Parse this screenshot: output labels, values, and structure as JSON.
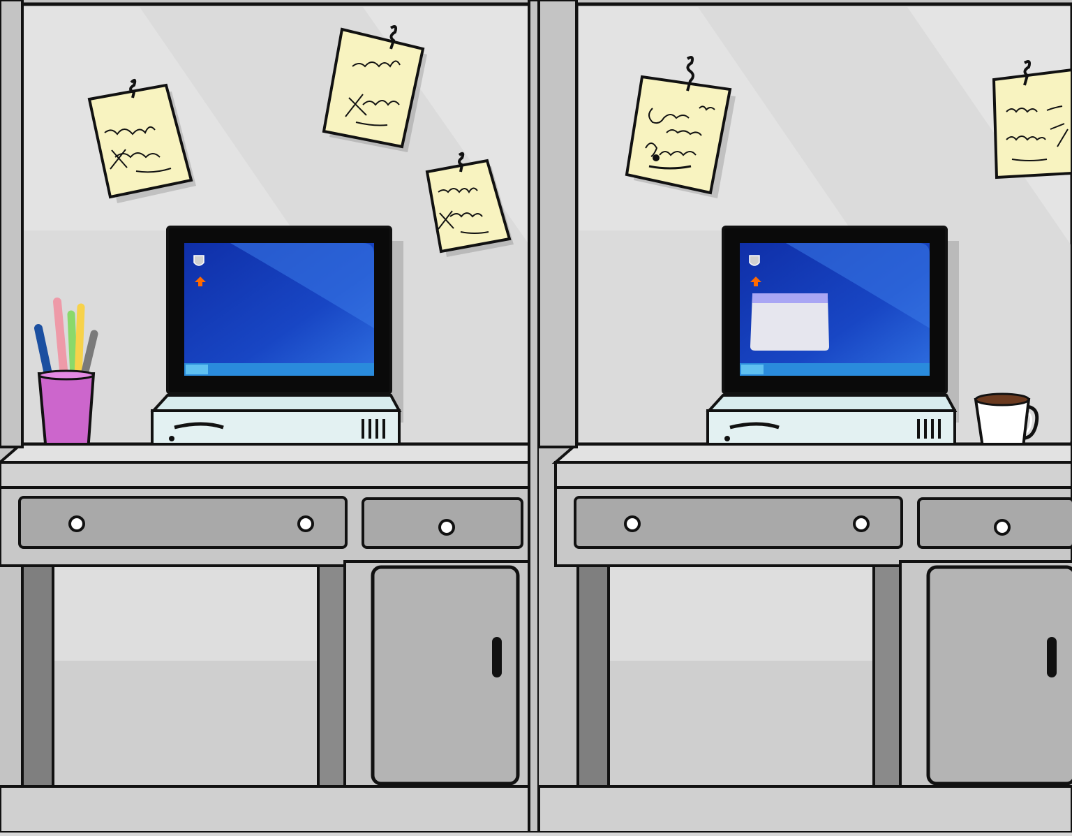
{
  "scene": "two-office-cubicles",
  "colors": {
    "wall": "#e4e4e4",
    "wall_shade": "#d2d2d2",
    "frame": "#c4c4c4",
    "outline": "#111111",
    "desk_top": "#e2e2e2",
    "desk_front": "#c8c8c8",
    "drawer": "#a9a9a9",
    "cabinet_door": "#b4b4b4",
    "under_desk": "#dedede",
    "floor": "#cfcfcf",
    "note_paper": "#f8f3c0",
    "screen": "#1846c4",
    "screen_glow": "#2f6fe0",
    "taskbar": "#2a8bdc",
    "computer_case": "#e3f1f2",
    "pen_cup": "#cc66cc",
    "coffee": "#6b3a1f",
    "window_bar": "#a9a6f4",
    "window_body": "#e6e6ee",
    "arrow_icon": "#ff6a00"
  },
  "left_cubicle": {
    "notes_count": 3,
    "has_pen_cup": true,
    "has_coffee_mug": false,
    "screen_window_open": false
  },
  "right_cubicle": {
    "notes_count": 2,
    "has_pen_cup": false,
    "has_coffee_mug": true,
    "screen_window_open": true
  },
  "screen_icons": [
    "shield-icon",
    "up-arrow-icon"
  ]
}
